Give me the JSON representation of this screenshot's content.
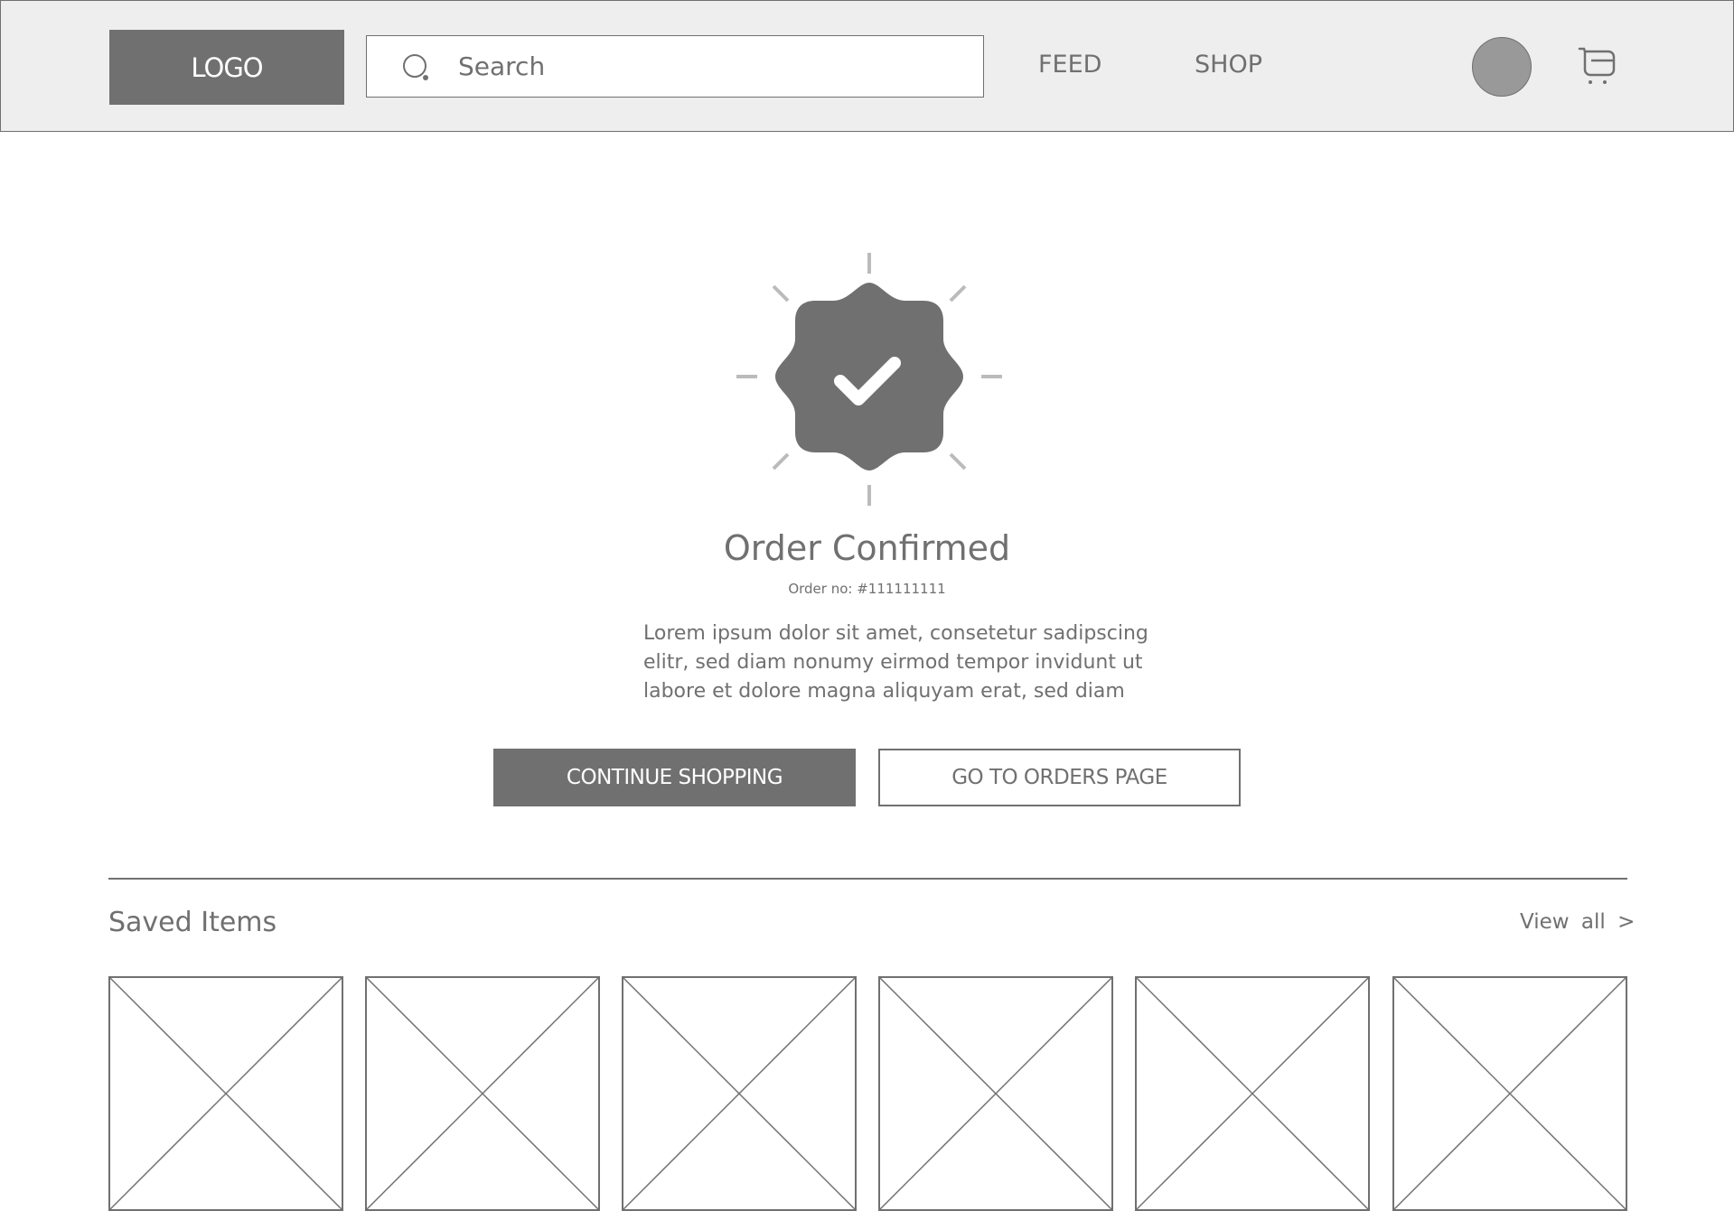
{
  "header": {
    "logo": "LOGO",
    "search": {
      "placeholder": "Search",
      "value": "",
      "icon": "search-icon"
    },
    "nav": [
      {
        "label": "FEED"
      },
      {
        "label": "SHOP"
      }
    ],
    "avatar_icon": "avatar",
    "cart_icon": "cart-icon"
  },
  "confirmation": {
    "icon": "verified-badge-check-icon",
    "title": "Order Confirmed",
    "order_number": "Order no: #111111111",
    "description_lines": [
      "Lorem ipsum dolor sit amet, consetetur sadipscing",
      "elitr, sed diam nonumy eirmod tempor invidunt ut",
      "labore et dolore magna aliquyam erat, sed diam"
    ],
    "primary_button": "CONTINUE SHOPPING",
    "secondary_button": "GO TO ORDERS PAGE"
  },
  "saved_items": {
    "title": "Saved Items",
    "view_all": "View all >",
    "items": [
      {
        "placeholder": "image-placeholder"
      },
      {
        "placeholder": "image-placeholder"
      },
      {
        "placeholder": "image-placeholder"
      },
      {
        "placeholder": "image-placeholder"
      },
      {
        "placeholder": "image-placeholder"
      },
      {
        "placeholder": "image-placeholder"
      }
    ]
  },
  "colors": {
    "header_bg": "#eeeeee",
    "primary": "#707070",
    "avatar": "#999999",
    "ray": "#bbbbbb"
  }
}
